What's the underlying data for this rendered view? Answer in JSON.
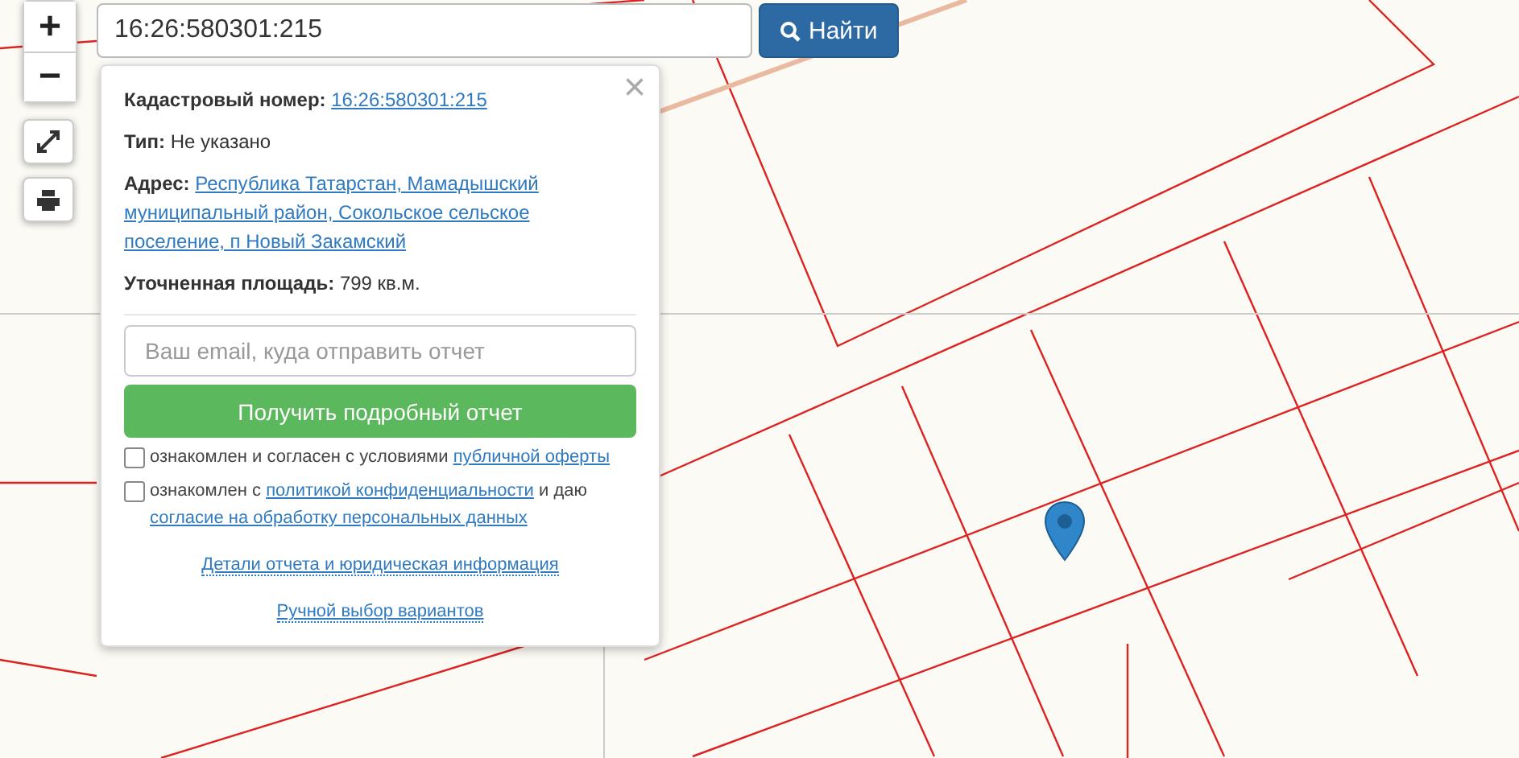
{
  "zoom_controls": {
    "zoom_in": "+",
    "zoom_out": "−"
  },
  "search": {
    "value": "16:26:580301:215",
    "button": "Найти"
  },
  "popup": {
    "close": "×",
    "fields": [
      {
        "kind": "link",
        "label": "Кадастровый номер:",
        "value": "16:26:580301:215"
      },
      {
        "kind": "text",
        "label": "Тип:",
        "value": "Не указано"
      },
      {
        "kind": "link",
        "label": "Адрес:",
        "value": "Республика Татарстан, Мамадышский муниципальный район, Сокольское сельское поселение, п Новый Закамский"
      },
      {
        "kind": "text",
        "label": "Уточненная площадь:",
        "value": "799 кв.м."
      }
    ],
    "email": {
      "placeholder": "Ваш email, куда отправить отчет"
    },
    "submit": "Получить подробный отчет",
    "agreements": [
      {
        "checked": false,
        "parts": [
          {
            "kind": "text",
            "text": "ознакомлен и согласен с условиями "
          },
          {
            "kind": "link",
            "text": "публичной оферты"
          }
        ]
      },
      {
        "checked": false,
        "parts": [
          {
            "kind": "text",
            "text": "ознакомлен с "
          },
          {
            "kind": "link",
            "text": "политикой конфиденциальности"
          },
          {
            "kind": "text",
            "text": " и даю "
          },
          {
            "kind": "link",
            "text": "согласие на обработку персональных данных"
          }
        ]
      }
    ],
    "links": [
      "Детали отчета и юридическая информация",
      "Ручной выбор вариантов"
    ]
  }
}
